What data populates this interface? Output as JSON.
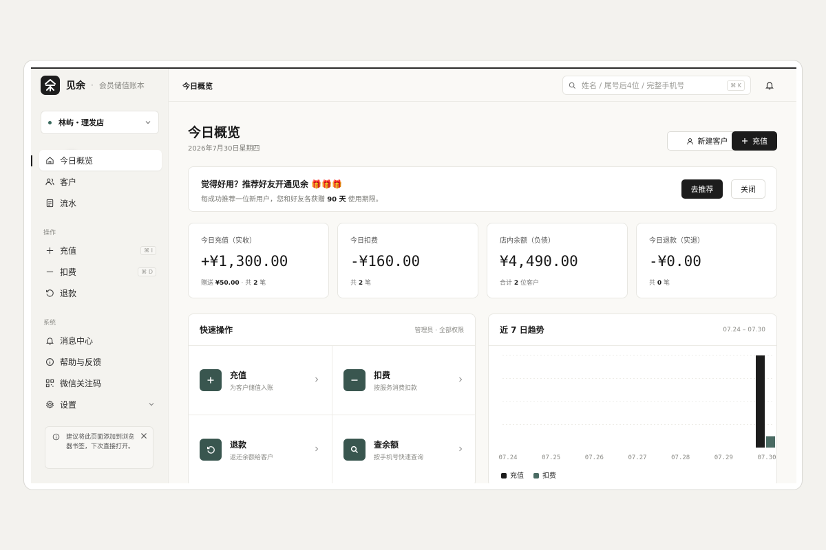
{
  "brand": {
    "name": "见余",
    "separator": "·",
    "subtitle": "会员储值账本"
  },
  "store": {
    "name": "林屿・理发店"
  },
  "nav": {
    "main": [
      {
        "label": "今日概览",
        "icon": "home-icon"
      },
      {
        "label": "客户",
        "icon": "users-icon"
      },
      {
        "label": "流水",
        "icon": "ledger-icon"
      }
    ],
    "ops_label": "操作",
    "ops": [
      {
        "label": "充值",
        "icon": "plus-icon",
        "shortcut": "⌘ I"
      },
      {
        "label": "扣费",
        "icon": "minus-icon",
        "shortcut": "⌘ D"
      },
      {
        "label": "退款",
        "icon": "undo-icon"
      }
    ],
    "system_label": "系统",
    "system": [
      {
        "label": "消息中心",
        "icon": "bell-icon"
      },
      {
        "label": "帮助与反馈",
        "icon": "info-icon"
      },
      {
        "label": "微信关注码",
        "icon": "qrcode-icon"
      },
      {
        "label": "设置",
        "icon": "gear-icon"
      }
    ]
  },
  "tip": {
    "text": "建议将此页面添加到浏览器书签，下次直接打开。"
  },
  "topbar": {
    "title": "今日概览",
    "search_placeholder": "姓名 / 尾号后4位 / 完整手机号",
    "search_shortcut": "⌘ K"
  },
  "page": {
    "title": "今日概览",
    "date": "2026年7月30日星期四",
    "new_customer_label": "新建客户",
    "recharge_label": "充值"
  },
  "banner": {
    "title": "觉得好用？推荐好友开通见余 🎁🎁🎁",
    "desc_before": "每成功推荐一位新用户，您和好友各获赠",
    "desc_bold": "90 天",
    "desc_after": "使用期限。",
    "refer_label": "去推荐",
    "close_label": "关闭"
  },
  "stats": [
    {
      "label": "今日充值（实收）",
      "value": "+¥1,300.00",
      "foot_a": "赠送",
      "foot_b": "¥50.00",
      "foot_c": "· 共",
      "foot_d": "2",
      "foot_e": "笔"
    },
    {
      "label": "今日扣费",
      "value": "-¥160.00",
      "foot_a": "共",
      "foot_b": "2",
      "foot_c": "笔"
    },
    {
      "label": "店内余额（负债）",
      "value": "¥4,490.00",
      "foot_a": "合计",
      "foot_b": "2",
      "foot_c": "位客户"
    },
    {
      "label": "今日退款（实退）",
      "value": "-¥0.00",
      "foot_a": "共",
      "foot_b": "0",
      "foot_c": "笔"
    }
  ],
  "quick": {
    "title": "快速操作",
    "meta": "管理员 · 全部权限",
    "items": [
      {
        "name": "充值",
        "desc": "为客户储值入账",
        "icon": "plus-icon"
      },
      {
        "name": "扣费",
        "desc": "按服务消费扣款",
        "icon": "minus-icon"
      },
      {
        "name": "退款",
        "desc": "返还余额给客户",
        "icon": "refund-icon"
      },
      {
        "name": "查余额",
        "desc": "按手机号快速查询",
        "icon": "search-icon"
      }
    ]
  },
  "trend": {
    "title": "近 7 日趋势",
    "range": "07.24 – 07.30"
  },
  "chart_data": {
    "type": "bar",
    "categories": [
      "07.24",
      "07.25",
      "07.26",
      "07.27",
      "07.28",
      "07.29",
      "07.30"
    ],
    "series": [
      {
        "name": "充值",
        "color": "#1c1c1c",
        "values": [
          0,
          0,
          0,
          0,
          0,
          0,
          1300
        ]
      },
      {
        "name": "扣费",
        "color": "#4a6b63",
        "values": [
          0,
          0,
          0,
          0,
          0,
          0,
          160
        ]
      }
    ],
    "ylim": [
      0,
      1300
    ],
    "grid": true,
    "legend": "bottom-left"
  },
  "colors": {
    "accent": "#1c1c1c",
    "teal": "#39564f",
    "status": "#3a6a5e"
  }
}
